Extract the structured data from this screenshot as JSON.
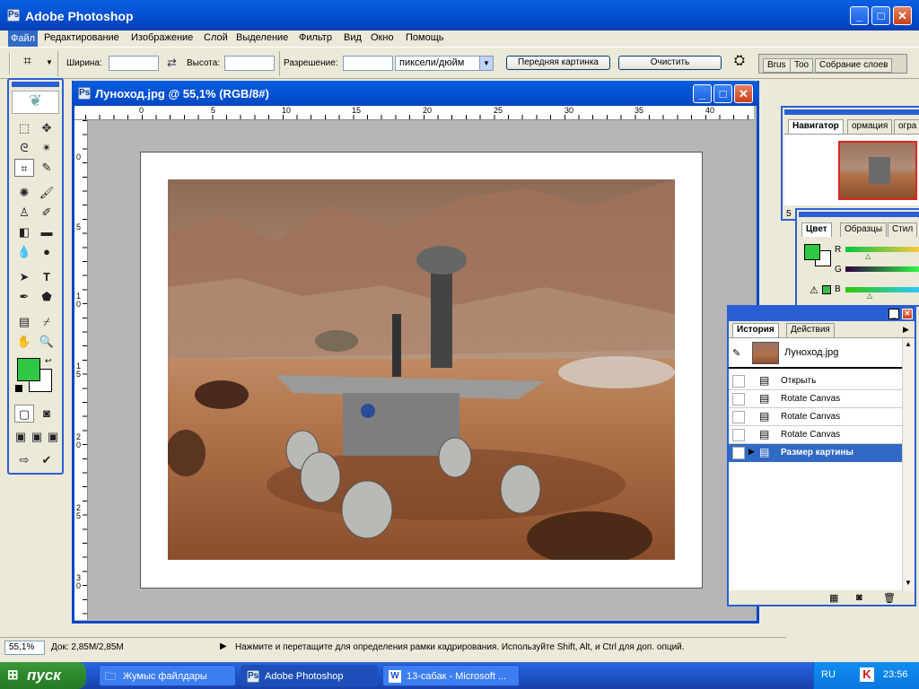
{
  "app": {
    "title": "Adobe Photoshop",
    "window_buttons": {
      "min": "_",
      "max": "□",
      "close": "✕"
    }
  },
  "menu": [
    "Файл",
    "Редактирование",
    "Изображение",
    "Слой",
    "Выделение",
    "Фильтр",
    "Вид",
    "Окно",
    "Помощь"
  ],
  "options": {
    "width_label": "Ширина:",
    "width_value": "",
    "height_label": "Высота:",
    "height_value": "",
    "resolution_label": "Разрешение:",
    "resolution_value": "",
    "units_value": "пиксели/дюйм",
    "front_image_button": "Передняя картинка",
    "clear_button": "Очистить",
    "well_tabs": [
      "Brus",
      "Too",
      "Собрание слоев"
    ]
  },
  "document": {
    "title": "Луноход.jpg @ 55,1% (RGB/8#)",
    "h_ruler": [
      "0",
      "5",
      "10",
      "15",
      "20",
      "25",
      "30",
      "35",
      "40"
    ],
    "v_ruler": [
      "0",
      "5",
      "1\n0",
      "1\n5",
      "2\n0",
      "2\n5",
      "3\n0"
    ]
  },
  "status": {
    "zoom": "55,1%",
    "doc_info": "Док: 2,85M/2,85M",
    "hint": "Нажмите и перетащите для определения рамки кадрирования. Используйте Shift, Alt, и Ctrl для доп. опций."
  },
  "panels": {
    "navigator": {
      "tabs": [
        "Навигатор",
        "ормация",
        "огра"
      ],
      "zoom": "5"
    },
    "color": {
      "tabs": [
        "Цвет",
        "Образцы",
        "Стил"
      ],
      "channels": [
        "R",
        "G",
        "B"
      ],
      "foreground": "#2ec843",
      "background": "#ffffff"
    },
    "history": {
      "tabs": [
        "История",
        "Действия"
      ],
      "snapshot": "Луноход.jpg",
      "items": [
        "Открыть",
        "Rotate Canvas",
        "Rotate Canvas",
        "Rotate Canvas",
        "Размер картины"
      ],
      "active_index": 4
    }
  },
  "taskbar": {
    "start": "пуск",
    "tasks": [
      "Жумыс файлдары",
      "Adobe Photoshop",
      "13-сабак - Microsoft ..."
    ],
    "active_task": 1,
    "lang": "RU",
    "time": "23:56"
  }
}
